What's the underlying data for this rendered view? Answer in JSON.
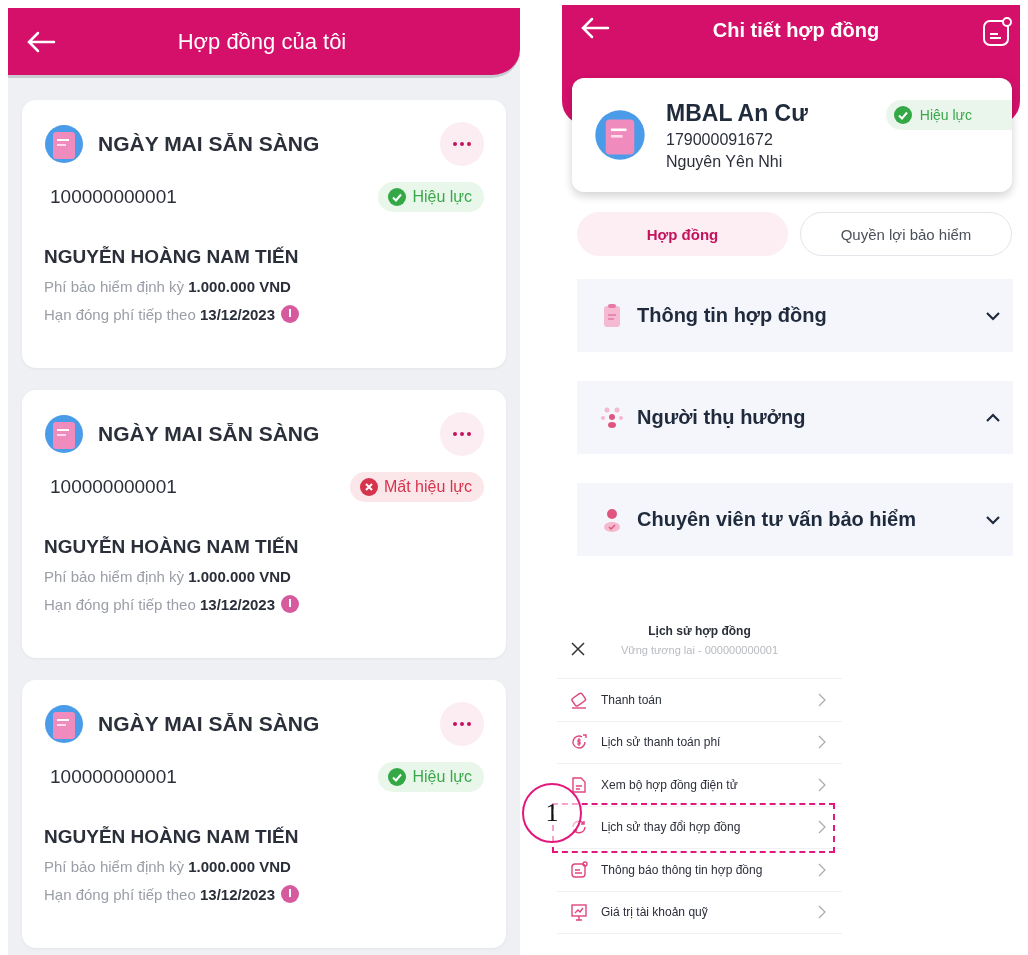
{
  "list_screen": {
    "title": "Hợp đồng của tôi",
    "contracts": [
      {
        "product": "NGÀY MAI SẴN SÀNG",
        "number": "100000000001",
        "status": {
          "kind": "active",
          "label": "Hiệu lực"
        },
        "holder": "NGUYỄN HOÀNG NAM TIẾN",
        "premium": "Phí bảo hiểm định kỳ **1.000.000 VND**",
        "due": "Hạn đóng phí tiếp theo **13/12/2023**"
      },
      {
        "product": "NGÀY MAI SẴN SÀNG",
        "number": "100000000001",
        "status": {
          "kind": "lapsed",
          "label": "Mất hiệu lực"
        },
        "holder": "NGUYỄN HOÀNG NAM TIẾN",
        "premium": "Phí bảo hiểm định kỳ **1.000.000 VND**",
        "due": "Hạn đóng phí tiếp theo **13/12/2023**"
      },
      {
        "product": "NGÀY MAI SẴN SÀNG",
        "number": "100000000001",
        "status": {
          "kind": "active",
          "label": "Hiệu lực"
        },
        "holder": "NGUYỄN HOÀNG NAM TIẾN",
        "premium": "Phí bảo hiểm định kỳ **1.000.000 VND**",
        "due": "Hạn đóng phí tiếp theo **13/12/2023**"
      }
    ]
  },
  "detail_screen": {
    "title": "Chi tiết hợp đồng",
    "contract": {
      "name": "MBAL An Cư",
      "number": "179000091672",
      "holder": "Nguyên Yên Nhi",
      "status": {
        "kind": "active",
        "label": "Hiệu lực"
      }
    },
    "tabs": [
      {
        "label": "Hợp đồng",
        "selected": true
      },
      {
        "label": "Quyền lợi bảo hiểm",
        "selected": false
      }
    ],
    "sections": [
      {
        "kind": "document",
        "label": "Thông tin hợp đồng",
        "expanded": false
      },
      {
        "kind": "people",
        "label": "Người thụ hưởng",
        "expanded": true
      },
      {
        "kind": "advisor",
        "label": "Chuyên viên tư vấn bảo hiểm",
        "expanded": false
      }
    ]
  },
  "history_sheet": {
    "title": "Lịch sử hợp đồng",
    "subtitle": "Vững tương lai - 000000000001",
    "items": [
      {
        "kind": "payment",
        "label": "Thanh toán",
        "highlighted": false
      },
      {
        "kind": "fee-history",
        "label": "Lịch sử thanh toán phí",
        "highlighted": false
      },
      {
        "kind": "document",
        "label": "Xem bộ hợp đồng điện tử",
        "highlighted": false
      },
      {
        "kind": "change",
        "label": "Lịch sử thay đổi hợp đồng",
        "highlighted": true
      },
      {
        "kind": "notice",
        "label": "Thông báo thông tin hợp đồng",
        "highlighted": false
      },
      {
        "kind": "fund",
        "label": "Giá trị tài khoản quỹ",
        "highlighted": false
      }
    ],
    "annotation": "1"
  }
}
